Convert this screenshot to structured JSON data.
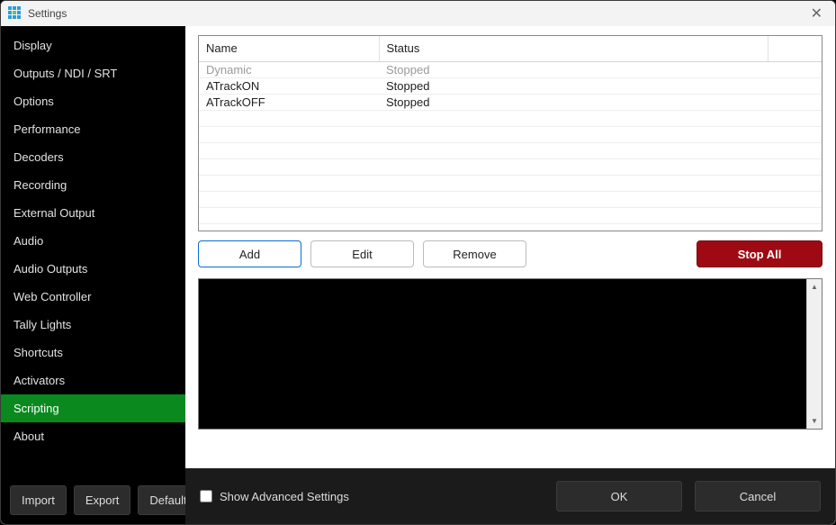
{
  "window": {
    "title": "Settings"
  },
  "sidebar": {
    "items": [
      {
        "label": "Display",
        "active": false
      },
      {
        "label": "Outputs / NDI / SRT",
        "active": false
      },
      {
        "label": "Options",
        "active": false
      },
      {
        "label": "Performance",
        "active": false
      },
      {
        "label": "Decoders",
        "active": false
      },
      {
        "label": "Recording",
        "active": false
      },
      {
        "label": "External Output",
        "active": false
      },
      {
        "label": "Audio",
        "active": false
      },
      {
        "label": "Audio Outputs",
        "active": false
      },
      {
        "label": "Web Controller",
        "active": false
      },
      {
        "label": "Tally Lights",
        "active": false
      },
      {
        "label": "Shortcuts",
        "active": false
      },
      {
        "label": "Activators",
        "active": false
      },
      {
        "label": "Scripting",
        "active": true
      },
      {
        "label": "About",
        "active": false
      }
    ],
    "footer": {
      "import": "Import",
      "export": "Export",
      "default": "Default"
    }
  },
  "scripts": {
    "columns": {
      "name": "Name",
      "status": "Status"
    },
    "rows": [
      {
        "name": "Dynamic",
        "status": "Stopped",
        "selected": true
      },
      {
        "name": "ATrackON",
        "status": "Stopped",
        "selected": false
      },
      {
        "name": "ATrackOFF",
        "status": "Stopped",
        "selected": false
      }
    ]
  },
  "actions": {
    "add": "Add",
    "edit": "Edit",
    "remove": "Remove",
    "stop_all": "Stop All"
  },
  "bottom": {
    "show_advanced": "Show Advanced Settings",
    "ok": "OK",
    "cancel": "Cancel"
  }
}
